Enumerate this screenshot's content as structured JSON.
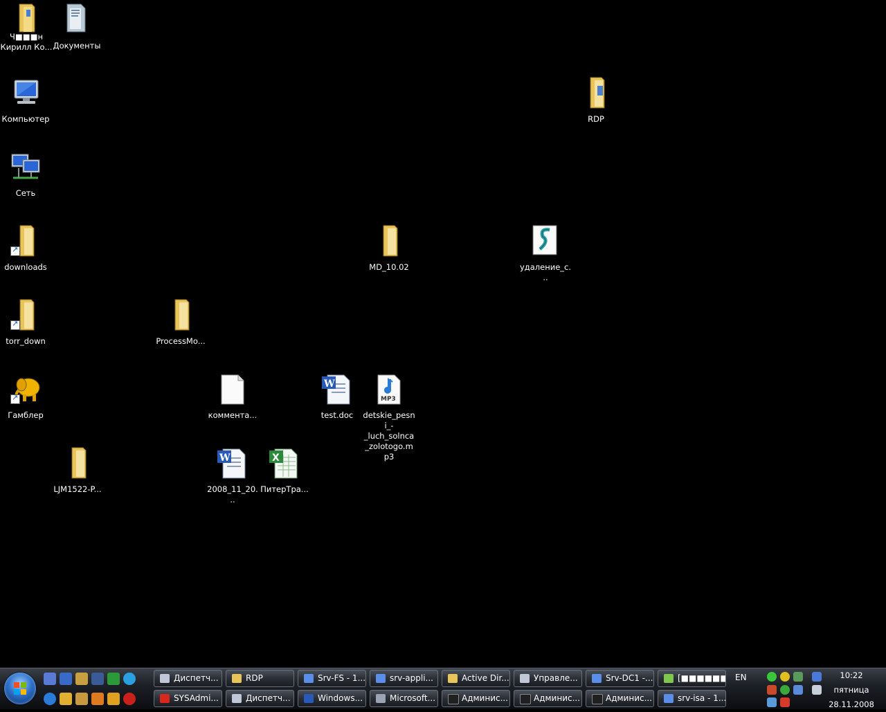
{
  "desktop": {
    "icons": [
      {
        "name": "user-folder",
        "label": "Кирилл Ко...",
        "label_top": "Ч■■■н"
      },
      {
        "name": "documents",
        "label": "Документы"
      },
      {
        "name": "computer",
        "label": "Компьютер"
      },
      {
        "name": "network",
        "label": "Сеть"
      },
      {
        "name": "downloads",
        "label": "downloads"
      },
      {
        "name": "torr-down",
        "label": "torr_down"
      },
      {
        "name": "gambler",
        "label": "Гамблер"
      },
      {
        "name": "ljm1522",
        "label": "LJM1522-P..."
      },
      {
        "name": "processmon",
        "label": "ProcessMo..."
      },
      {
        "name": "comments-file",
        "label": "коммента..."
      },
      {
        "name": "doc-2008-11-20",
        "label": "2008_11_20..."
      },
      {
        "name": "piter-xls",
        "label": "ПитерТра..."
      },
      {
        "name": "test-doc",
        "label": "test.doc"
      },
      {
        "name": "mp3-file",
        "label": "detskie_pesni_-_luch_solnca_zolotogo.mp3"
      },
      {
        "name": "md-10-02",
        "label": "MD_10.02"
      },
      {
        "name": "script-file",
        "label": "удаление_с..."
      },
      {
        "name": "rdp-folder",
        "label": "RDP"
      }
    ]
  },
  "taskbar": {
    "row1": [
      {
        "label": "Диспетч...",
        "color": "#c0c8d8"
      },
      {
        "label": "RDP",
        "color": "#e8c45a"
      },
      {
        "label": "Srv-FS - 1...",
        "color": "#5a8ee8"
      },
      {
        "label": "srv-appli...",
        "color": "#5a8ee8"
      },
      {
        "label": "Active Dir...",
        "color": "#e8c45a"
      },
      {
        "label": "Управле...",
        "color": "#c0c8d8"
      },
      {
        "label": "Srv-DC1 -...",
        "color": "#5a8ee8"
      },
      {
        "label": "[■■■■■■",
        "color": "#7ec850"
      }
    ],
    "row2": [
      {
        "label": "SYSAdmi...",
        "color": "#d8281e"
      },
      {
        "label": "Диспетч...",
        "color": "#c0c8d8"
      },
      {
        "label": "Windows...",
        "color": "#2a5ab8"
      },
      {
        "label": "Microsoft...",
        "color": "#9aa4b4"
      },
      {
        "label": "Админис...",
        "color": "#202020"
      },
      {
        "label": "Админис...",
        "color": "#202020"
      },
      {
        "label": "Админис...",
        "color": "#202020"
      },
      {
        "label": "srv-isa - 1...",
        "color": "#5a8ee8"
      }
    ],
    "language": "EN",
    "clock": {
      "time": "10:22",
      "day": "пятница",
      "date": "28.11.2008"
    }
  }
}
